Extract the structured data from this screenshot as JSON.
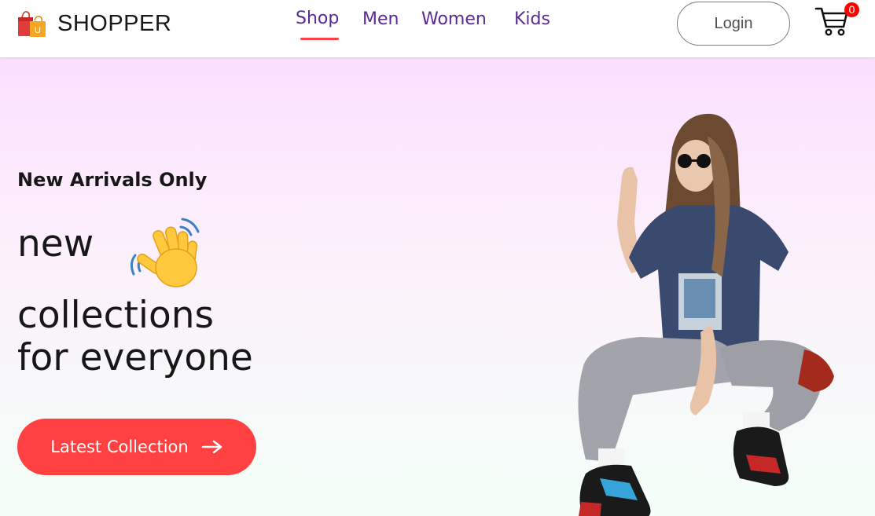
{
  "brand": {
    "name": "SHOPPER",
    "logo_icon": "shopping-bags-icon"
  },
  "nav": {
    "items": [
      {
        "label": "Shop",
        "active": true
      },
      {
        "label": "Men",
        "active": false
      },
      {
        "label": "Women",
        "active": false
      },
      {
        "label": "Kids",
        "active": false
      }
    ]
  },
  "header": {
    "login_label": "Login",
    "cart_icon": "shopping-cart-icon",
    "cart_count": "0"
  },
  "hero": {
    "subtitle": "New Arrivals Only",
    "line1": "new",
    "wave_icon": "waving-hand-icon",
    "line2": "collections",
    "line3": "for everyone",
    "cta_label": "Latest Collection",
    "cta_icon": "arrow-right-icon",
    "image": "model-sitting-photo"
  },
  "colors": {
    "accent": "#ff4141",
    "nav_text": "#5a2a94",
    "hero_gradient_top": "#fbe0ff",
    "hero_gradient_bottom": "#f3fff8",
    "badge": "#ff0000"
  }
}
